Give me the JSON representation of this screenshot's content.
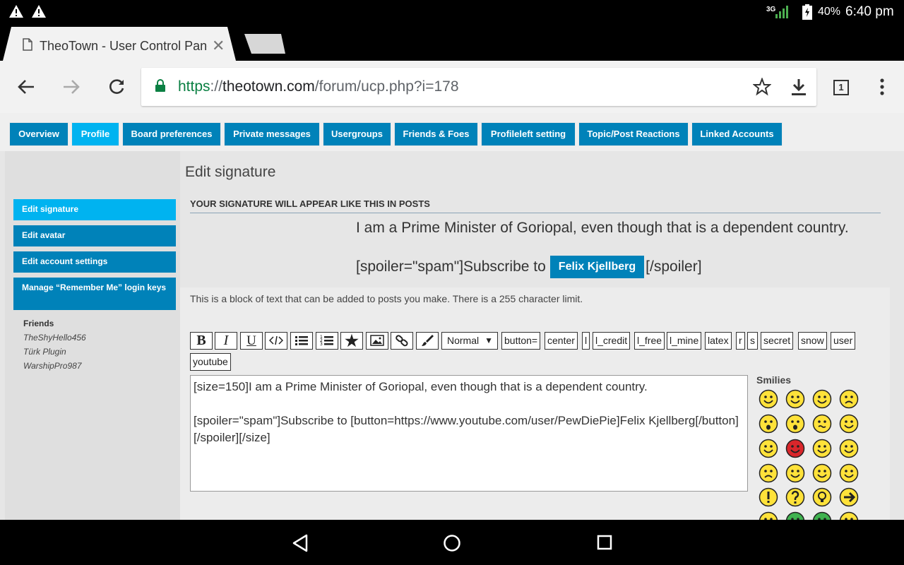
{
  "status_bar": {
    "network": "3G",
    "battery": "40%",
    "time": "6:40 pm",
    "icons": [
      "warning-icon",
      "warning-icon",
      "signal-icon",
      "battery-charging-icon"
    ]
  },
  "browser": {
    "tab_title": "TheoTown - User Control Panel",
    "url_scheme": "https",
    "url_sep": "://",
    "url_host": "theotown.com",
    "url_path": "/forum/ucp.php?i=178",
    "tab_count": "1"
  },
  "nav": {
    "tabs": [
      "Overview",
      "Profile",
      "Board preferences",
      "Private messages",
      "Usergroups",
      "Friends & Foes",
      "Profileleft setting",
      "Topic/Post Reactions",
      "Linked Accounts"
    ],
    "active": "Profile"
  },
  "sidebar": {
    "items": [
      "Edit signature",
      "Edit avatar",
      "Edit account settings",
      "Manage “Remember Me” login keys"
    ],
    "friends_heading": "Friends",
    "friends": [
      "TheShyHello456",
      "Türk Plugin",
      "WarshipPro987"
    ]
  },
  "main": {
    "heading": "Edit signature",
    "preview_heading": "YOUR SIGNATURE WILL APPEAR LIKE THIS IN POSTS",
    "preview_line1": "I am a Prime Minister of Goriopal, even though that is a dependent country.",
    "preview_line2_before": "[spoiler=\"spam\"]Subscribe to",
    "preview_button": "Felix Kjellberg",
    "preview_line2_after": "[/spoiler]",
    "hint": "This is a block of text that can be added to posts you make. There is a 255 character limit.",
    "font_size_select": "Normal",
    "bbcode_buttons": [
      "button=",
      "center",
      "l",
      "l_credit",
      "l_free",
      "l_mine",
      "latex",
      "r",
      "s",
      "secret",
      "snow",
      "user",
      "youtube"
    ],
    "textarea_value": "[size=150]I am a Prime Minister of Goriopal, even though that is a dependent country.\n\n[spoiler=\"spam\"]Subscribe to [button=https://www.youtube.com/user/PewDiePie]Felix Kjellberg[/button][/spoiler][/size]",
    "smilies_heading": "Smilies"
  },
  "colors": {
    "primary": "#0082b9",
    "active": "#00b3f0",
    "url_green": "#0b8043"
  }
}
